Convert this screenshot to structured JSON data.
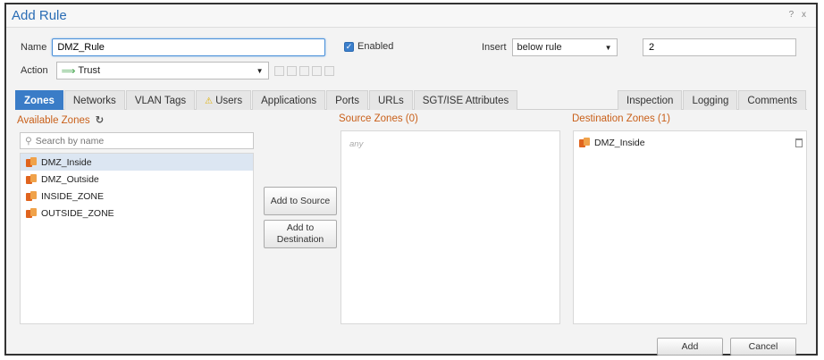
{
  "window": {
    "title": "Add Rule",
    "controls": "? x"
  },
  "form": {
    "name_label": "Name",
    "name_value": "DMZ_Rule",
    "enabled_label": "Enabled",
    "insert_label": "Insert",
    "insert_position": "below rule",
    "insert_value": "2",
    "action_label": "Action",
    "action_value": "Trust"
  },
  "tabs": [
    {
      "label": "Zones",
      "active": true
    },
    {
      "label": "Networks"
    },
    {
      "label": "VLAN Tags"
    },
    {
      "label": "Users",
      "warning": true
    },
    {
      "label": "Applications"
    },
    {
      "label": "Ports"
    },
    {
      "label": "URLs"
    },
    {
      "label": "SGT/ISE Attributes"
    },
    {
      "label": "Inspection"
    },
    {
      "label": "Logging"
    },
    {
      "label": "Comments"
    }
  ],
  "available_zones": {
    "title": "Available Zones",
    "search_placeholder": "Search by name",
    "items": [
      "DMZ_Inside",
      "DMZ_Outside",
      "INSIDE_ZONE",
      "OUTSIDE_ZONE"
    ]
  },
  "buttons": {
    "add_to_source": "Add to Source",
    "add_to_destination": "Add to Destination",
    "add": "Add",
    "cancel": "Cancel"
  },
  "source_zones": {
    "title": "Source Zones (0)",
    "empty_text": "any"
  },
  "destination_zones": {
    "title": "Destination Zones (1)",
    "items": [
      "DMZ_Inside"
    ]
  },
  "colors": {
    "accent": "#3a7cc7",
    "panel_title": "#c9601a",
    "title": "#2a6db5"
  }
}
